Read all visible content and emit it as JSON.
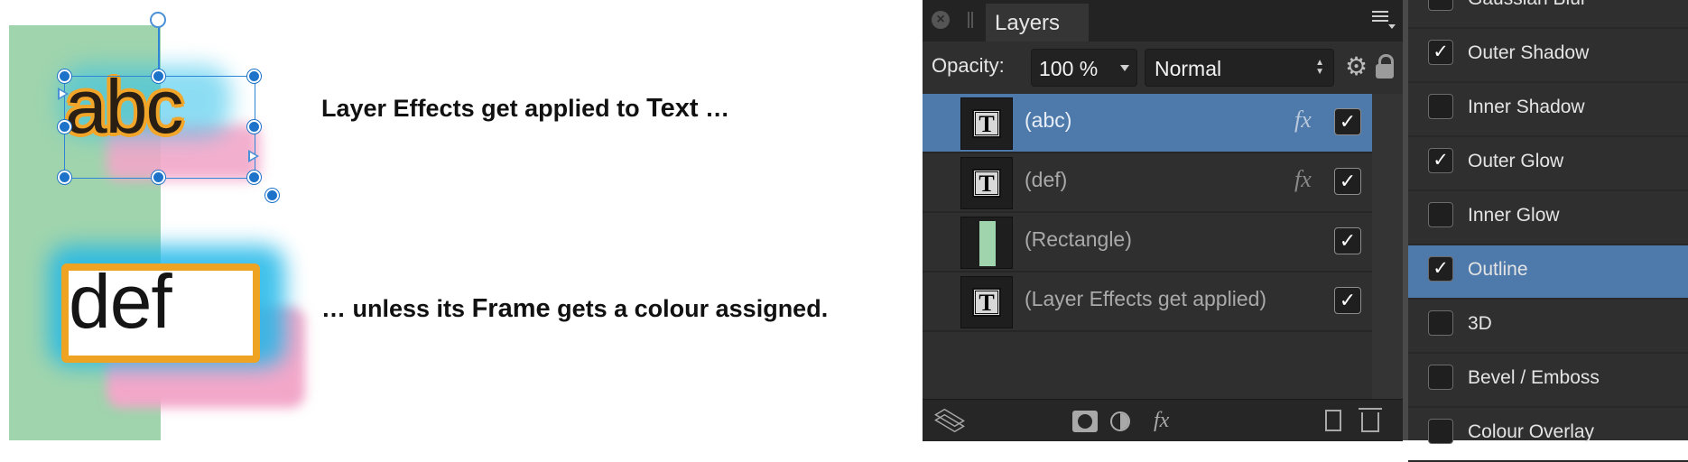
{
  "canvas": {
    "sample_abc": "abc",
    "sample_def": "def",
    "caption1": {
      "before": "Layer Effects get applied to ",
      "bold": "Text",
      "after": " …"
    },
    "caption2": {
      "before": "… unless its ",
      "bold": "Frame",
      "after": " gets a colour assigned."
    }
  },
  "layers_panel": {
    "title": "Layers",
    "opacity_label": "Opacity:",
    "opacity_value": "100 %",
    "blend_mode": "Normal",
    "layers": [
      {
        "name": "(abc)",
        "type": "text",
        "fx": "fx",
        "visible": "✓",
        "selected": true
      },
      {
        "name": "(def)",
        "type": "text",
        "fx": "fx",
        "visible": "✓",
        "selected": false
      },
      {
        "name": "(Rectangle)",
        "type": "rectangle",
        "fx": "",
        "visible": "✓",
        "selected": false
      },
      {
        "name": "(Layer Effects get applied)",
        "type": "text",
        "fx": "",
        "visible": "✓",
        "selected": false
      }
    ],
    "thumb_text_glyph": "T",
    "footer_fx": "fx"
  },
  "effects_panel": {
    "items": [
      {
        "label": "Gaussian Blur",
        "checked": ""
      },
      {
        "label": "Outer Shadow",
        "checked": "✓"
      },
      {
        "label": "Inner Shadow",
        "checked": ""
      },
      {
        "label": "Outer Glow",
        "checked": "✓"
      },
      {
        "label": "Inner Glow",
        "checked": ""
      },
      {
        "label": "Outline",
        "checked": "✓"
      },
      {
        "label": "3D",
        "checked": ""
      },
      {
        "label": "Bevel / Emboss",
        "checked": ""
      },
      {
        "label": "Colour Overlay",
        "checked": ""
      }
    ]
  },
  "colors": {
    "selection_blue": "#4e7aab",
    "panel_bg": "#2f2f2f",
    "rect_green": "#9fd4ad",
    "outline_orange": "#efa323",
    "glow_cyan": "#1fb7e8",
    "shadow_pink": "#f2a7c9"
  }
}
